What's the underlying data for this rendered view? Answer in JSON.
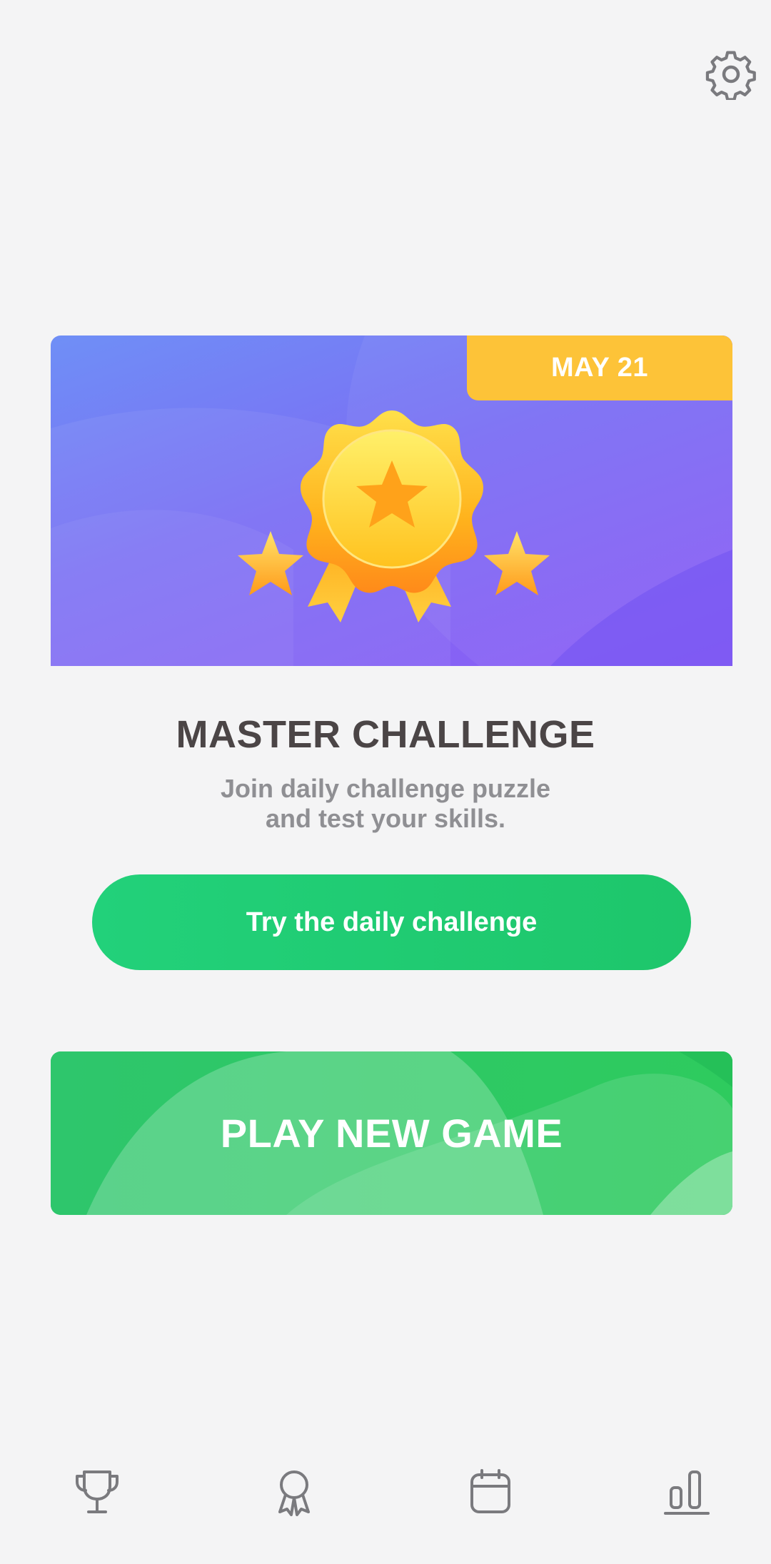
{
  "header": {
    "settings_icon": "gear-icon"
  },
  "banner": {
    "date_label": "MAY 21",
    "artwork": "medal-with-stars",
    "accent_color": "#fdc338"
  },
  "challenge": {
    "title": "MASTER CHALLENGE",
    "subtitle_line1": "Join daily challenge puzzle",
    "subtitle_line2": "and test your skills.",
    "button_label": "Try the daily challenge"
  },
  "play": {
    "button_label": "PLAY NEW GAME"
  },
  "colors": {
    "primary_green": "#1ec66b",
    "banner_purple": "#7b6ef4",
    "badge_yellow": "#fdc338",
    "title_text": "#4b4546",
    "muted_text": "#8f8f93"
  },
  "bottom_nav": {
    "items": [
      {
        "icon": "trophy-icon"
      },
      {
        "icon": "award-icon"
      },
      {
        "icon": "calendar-icon"
      },
      {
        "icon": "stats-icon"
      }
    ]
  }
}
